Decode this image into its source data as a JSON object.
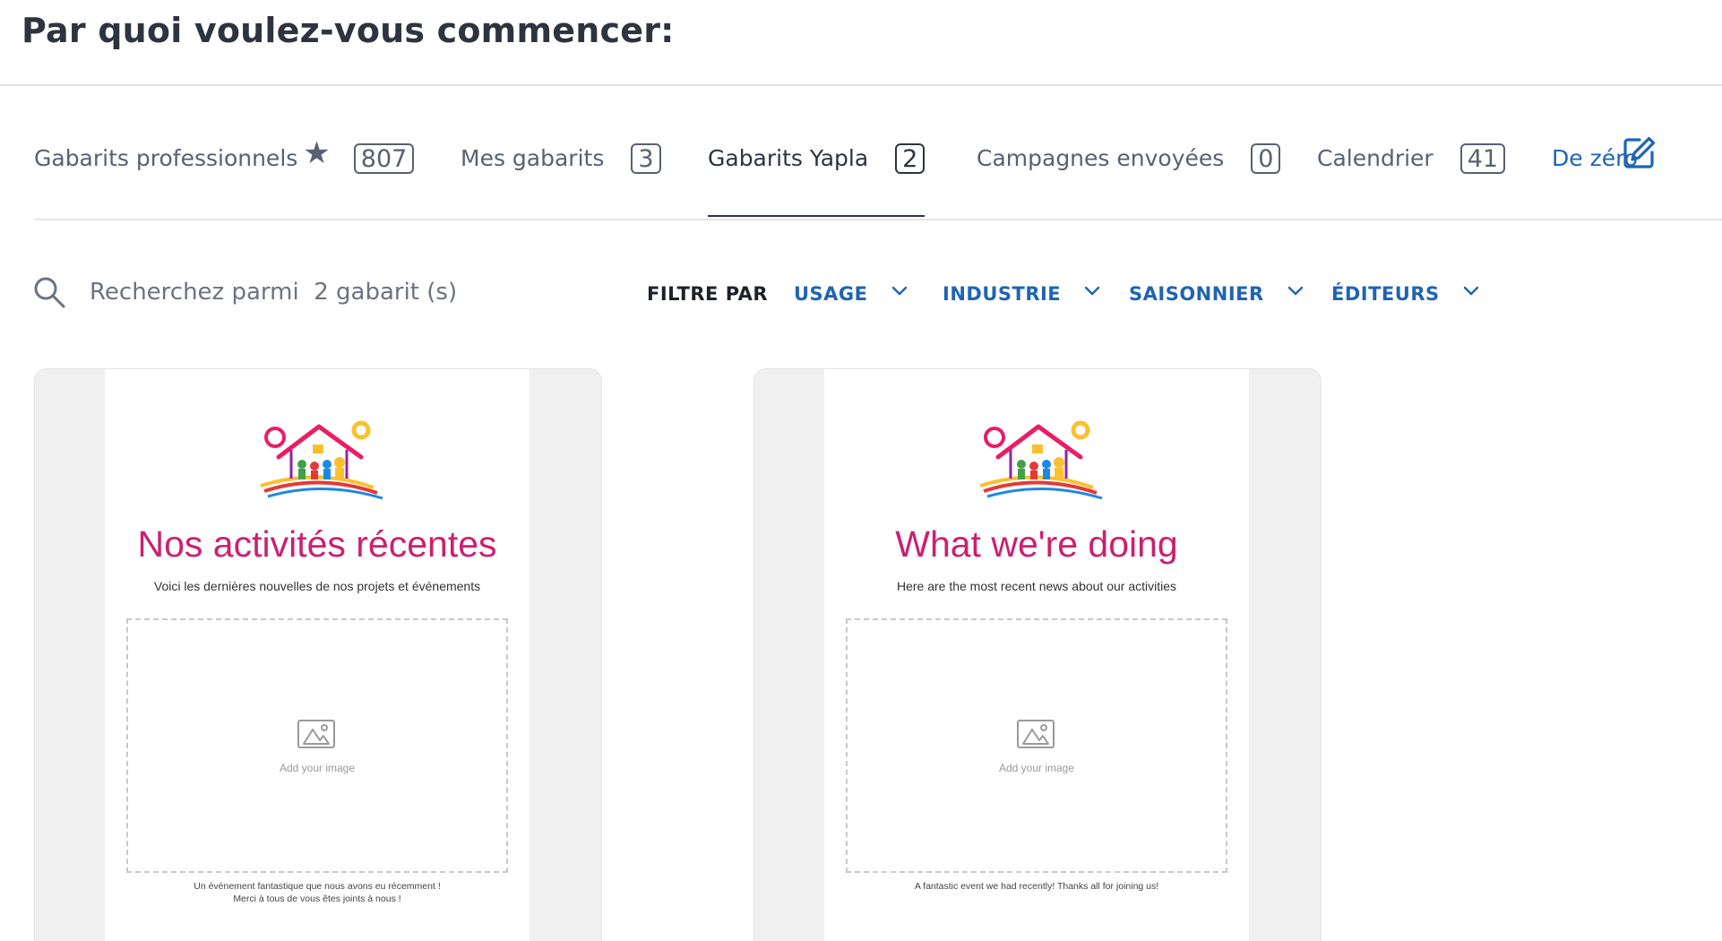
{
  "header": {
    "title": "Par quoi voulez-vous commencer:"
  },
  "tabs": [
    {
      "label": "Gabarits professionnels",
      "count": "807",
      "icon": "star-icon"
    },
    {
      "label": "Mes gabarits",
      "count": "3"
    },
    {
      "label": "Gabarits Yapla",
      "count": "2",
      "active": true
    },
    {
      "label": "Campagnes envoyées",
      "count": "0"
    },
    {
      "label": "Calendrier",
      "count": "41"
    },
    {
      "label": "De zéro",
      "icon": "edit-icon"
    }
  ],
  "search": {
    "placeholder": "Recherchez parmi  2 gabarit (s)"
  },
  "filters": {
    "label": "FILTRE PAR",
    "items": [
      "USAGE",
      "INDUSTRIE",
      "SAISONNIER",
      "ÉDITEURS"
    ]
  },
  "cards": [
    {
      "title": "Nos activités récentes",
      "subtitle": "Voici les dernières nouvelles de nos projets et événements",
      "placeholder": "Add your image",
      "caption": [
        "Un événement fantastique que nous avons eu récemment !",
        "Merci à tous de vous êtes joints à nous !"
      ]
    },
    {
      "title": "What we're doing",
      "subtitle": "Here are the most recent news about our activities",
      "placeholder": "Add your image",
      "caption": [
        "A fantastic event we had recently! Thanks all for joining us!"
      ]
    }
  ],
  "colors": {
    "accent": "#1f64b2",
    "title_pink": "#cc1f70",
    "text": "#2d3440",
    "muted": "#586170"
  }
}
